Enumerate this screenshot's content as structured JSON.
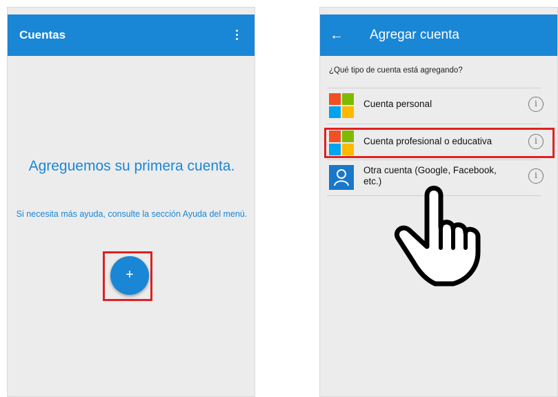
{
  "left_screen": {
    "appbar_title": "Cuentas",
    "empty_title": "Agreguemos su primera cuenta.",
    "help_text": "Si necesita más ayuda, consulte la sección Ayuda del menú.",
    "fab_label": "+"
  },
  "right_screen": {
    "appbar_title": "Agregar cuenta",
    "back_icon": "←",
    "question": "¿Qué tipo de cuenta está agregando?",
    "options": [
      {
        "label": "Cuenta personal",
        "icon": "microsoft-logo"
      },
      {
        "label": "Cuenta profesional o educativa",
        "icon": "microsoft-logo"
      },
      {
        "label": "Otra cuenta (Google, Facebook, etc.)",
        "icon": "person-icon"
      }
    ],
    "info_glyph": "i"
  },
  "colors": {
    "accent": "#1a86d6",
    "highlight": "#e02020",
    "ms_red": "#f25022",
    "ms_green": "#7fba00",
    "ms_blue": "#00a4ef",
    "ms_yellow": "#ffb900"
  }
}
